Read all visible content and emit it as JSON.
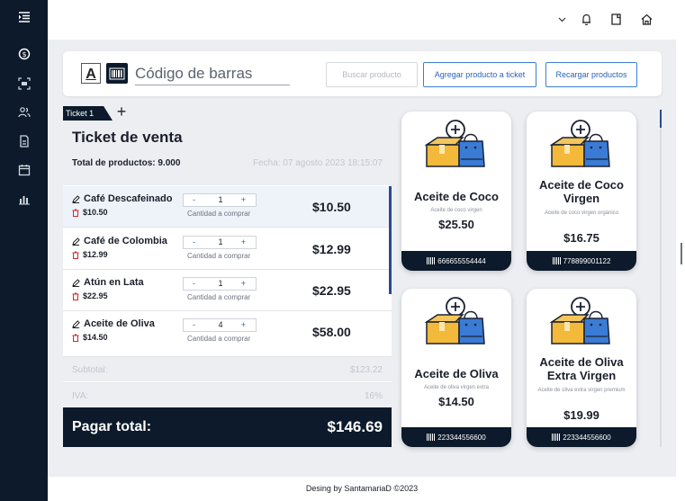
{
  "sidebar": {
    "items": [
      {
        "icon": "menu-collapse-icon"
      },
      {
        "icon": "dollar-icon"
      },
      {
        "icon": "scan-icon"
      },
      {
        "icon": "users-icon"
      },
      {
        "icon": "document-icon"
      },
      {
        "icon": "calendar-icon"
      },
      {
        "icon": "chart-icon"
      }
    ]
  },
  "topbar": {
    "icons": [
      "chevron-down-icon",
      "bell-icon",
      "note-icon",
      "home-icon"
    ]
  },
  "search": {
    "font_label": "A",
    "barcode_placeholder": "Código de barras",
    "search_button": "Buscar producto",
    "add_button": "Agregar producto a ticket",
    "reload_button": "Recargar productos"
  },
  "tabs": {
    "active": "Ticket 1",
    "add_label": "+"
  },
  "ticket": {
    "title": "Ticket de venta",
    "total_products": "Total de productos: 9.000",
    "date": "Fecha: 07 agosto 2023 18:15:07",
    "qty_hint": "Cantidad a comprar",
    "minus": "-",
    "plus": "+",
    "items": [
      {
        "name": "Café Descafeinado",
        "unit_price": "$10.50",
        "qty": "1",
        "total": "$10.50"
      },
      {
        "name": "Café de Colombia",
        "unit_price": "$12.99",
        "qty": "1",
        "total": "$12.99"
      },
      {
        "name": "Atún en Lata",
        "unit_price": "$22.95",
        "qty": "1",
        "total": "$22.95"
      },
      {
        "name": "Aceite de Oliva",
        "unit_price": "$14.50",
        "qty": "4",
        "total": "$58.00"
      }
    ],
    "subtotal_label": "Subtotal:",
    "subtotal_value": "$123.22",
    "iva_label": "IVA:",
    "iva_value": "16%",
    "pay_label": "Pagar total:",
    "pay_value": "$146.69"
  },
  "products": [
    {
      "name": "Aceite de Coco",
      "desc": "Aceite de coco virgen",
      "price": "$25.50",
      "code": "666655554444"
    },
    {
      "name": "Aceite de Coco Virgen",
      "desc": "Aceite de coco virgen orgánico",
      "price": "$16.75",
      "code": "778899001122"
    },
    {
      "name": "Aceite de Oliva",
      "desc": "Aceite de oliva virgen extra",
      "price": "$14.50",
      "code": "223344556600"
    },
    {
      "name": "Aceite de Oliva Extra Virgen",
      "desc": "Aceite de oliva extra virgen premium",
      "price": "$19.99",
      "code": "223344556600"
    }
  ],
  "footer": {
    "text": "Desing by SantamariaD ©2023"
  },
  "colors": {
    "navy": "#0c1a2b",
    "accent_blue": "#2a63b8",
    "background": "#eceef2"
  }
}
